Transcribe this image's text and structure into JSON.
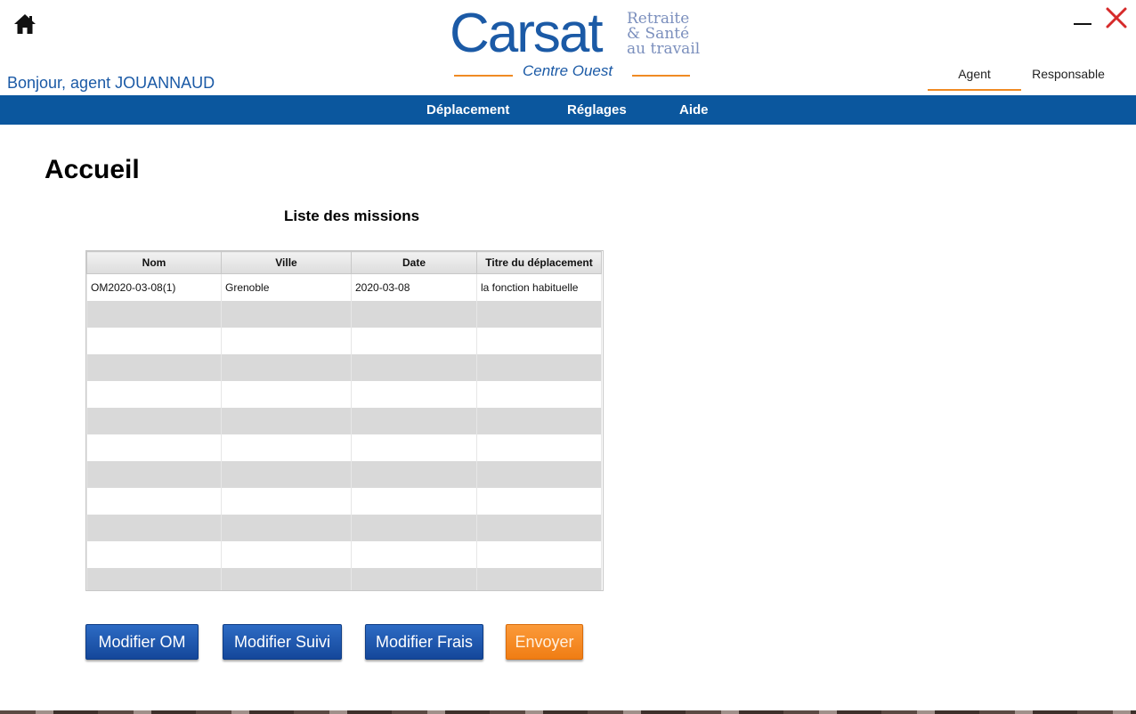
{
  "window": {
    "home_icon": "home-icon",
    "minimize_icon": "minimize-icon",
    "close_icon": "close-icon",
    "close_color": "#d62a2a"
  },
  "logo": {
    "brand": "Carsat",
    "line1": "Retraite",
    "line2": "& Santé",
    "line3": "au travail",
    "region": "Centre Ouest",
    "brand_color": "#1b5aa6",
    "accent_color": "#f08a23"
  },
  "greeting": "Bonjour, agent JOUANNAUD",
  "roles": {
    "agent": "Agent",
    "responsable": "Responsable"
  },
  "nav": {
    "items": [
      "Déplacement",
      "Réglages",
      "Aide"
    ],
    "color": "#0b579e"
  },
  "page_title": "Accueil",
  "missions": {
    "title": "Liste des missions",
    "columns": [
      "Nom",
      "Ville",
      "Date",
      "Titre du déplacement"
    ],
    "rows": [
      [
        "OM2020-03-08(1)",
        "Grenoble",
        "2020-03-08",
        "la fonction habituelle"
      ]
    ]
  },
  "buttons": {
    "modifier_om": "Modifier OM",
    "modifier_suivi": "Modifier Suivi",
    "modifier_frais": "Modifier Frais",
    "envoyer": "Envoyer"
  }
}
